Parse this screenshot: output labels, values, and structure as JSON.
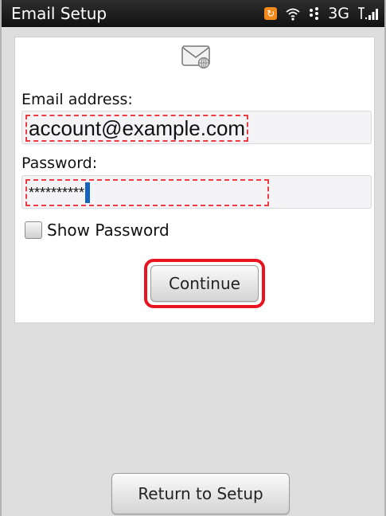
{
  "statusbar": {
    "title": "Email Setup",
    "network": "3G",
    "icons": [
      "sync-icon",
      "wifi-icon",
      "bluetooth-icon",
      "signal-icon"
    ]
  },
  "form": {
    "envelope_icon": "envelope-icon",
    "email_label": "Email address:",
    "email_value": "account@example.com",
    "password_label": "Password:",
    "password_value": "**********",
    "show_password_label": "Show Password",
    "show_password_checked": false,
    "continue_label": "Continue"
  },
  "footer": {
    "return_label": "Return to Setup"
  },
  "colors": {
    "highlight": "#e8141f",
    "cursor": "#1565c0",
    "dashed_border": "#ee3b44"
  }
}
